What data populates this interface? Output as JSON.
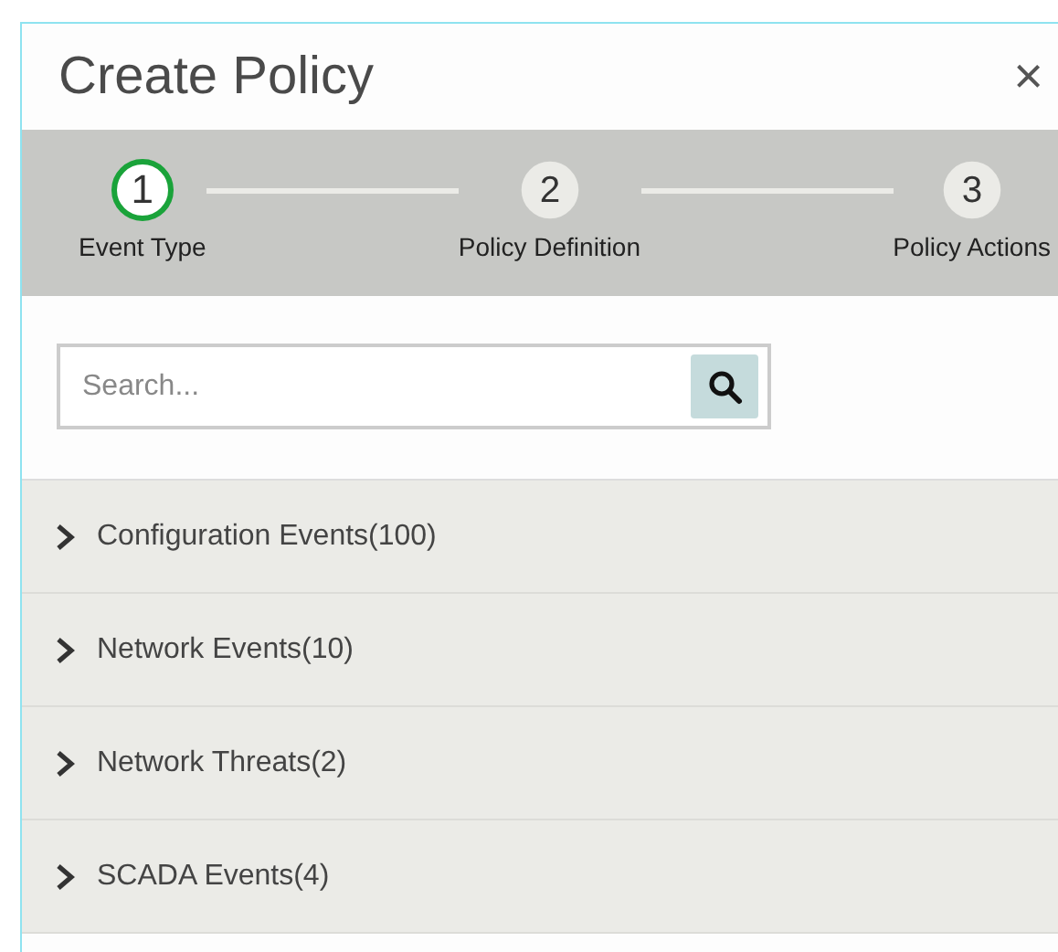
{
  "dialog": {
    "title": "Create Policy",
    "close": "×"
  },
  "steps": [
    {
      "number": "1",
      "label": "Event Type",
      "selected": true
    },
    {
      "number": "2",
      "label": "Policy Definition",
      "selected": false
    },
    {
      "number": "3",
      "label": "Policy Actions",
      "selected": false
    }
  ],
  "search": {
    "placeholder": "Search..."
  },
  "categories": [
    {
      "label": "Configuration Events(100)",
      "expanded": false
    },
    {
      "label": "Network Events(10)",
      "expanded": false
    },
    {
      "label": "Network Threats(2)",
      "expanded": false
    },
    {
      "label": "SCADA Events(4)",
      "expanded": false
    }
  ]
}
